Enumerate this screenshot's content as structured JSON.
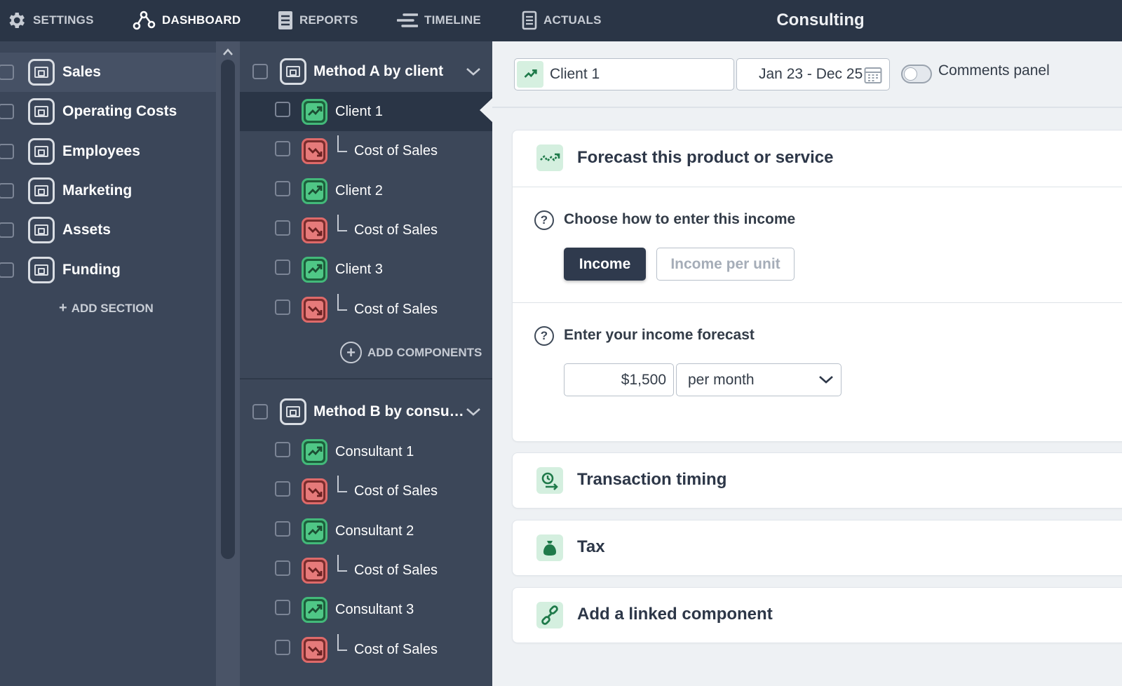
{
  "colors": {
    "topbar": "#2a3546",
    "sidebar": "#3b4659",
    "green_accent": "#43b97a",
    "red_accent": "#de6a6a",
    "primary_button": "#2f3a4d"
  },
  "nav": [
    {
      "label": "SETTINGS",
      "icon": "gear-icon"
    },
    {
      "label": "DASHBOARD",
      "icon": "network-nodes-icon",
      "active": true
    },
    {
      "label": "REPORTS",
      "icon": "report-icon"
    },
    {
      "label": "TIMELINE",
      "icon": "timeline-icon"
    },
    {
      "label": "ACTUALS",
      "icon": "actuals-document-icon"
    }
  ],
  "app_title": "Consulting",
  "sections": [
    {
      "label": "Sales",
      "active": true
    },
    {
      "label": "Operating Costs"
    },
    {
      "label": "Employees"
    },
    {
      "label": "Marketing"
    },
    {
      "label": "Assets"
    },
    {
      "label": "Funding"
    }
  ],
  "add_section_label": "ADD SECTION",
  "groups": [
    {
      "title": "Method A by client",
      "items": [
        {
          "label": "Client 1",
          "kind": "income",
          "active": true
        },
        {
          "label": "Cost of Sales",
          "kind": "cost"
        },
        {
          "label": "Client 2",
          "kind": "income"
        },
        {
          "label": "Cost of Sales",
          "kind": "cost"
        },
        {
          "label": "Client 3",
          "kind": "income"
        },
        {
          "label": "Cost of Sales",
          "kind": "cost"
        }
      ],
      "add_label": "ADD COMPONENTS"
    },
    {
      "title": "Method B by consu…",
      "items": [
        {
          "label": "Consultant 1",
          "kind": "income"
        },
        {
          "label": "Cost of Sales",
          "kind": "cost"
        },
        {
          "label": "Consultant 2",
          "kind": "income"
        },
        {
          "label": "Cost of Sales",
          "kind": "cost"
        },
        {
          "label": "Consultant 3",
          "kind": "income"
        },
        {
          "label": "Cost of Sales",
          "kind": "cost"
        }
      ]
    }
  ],
  "toolbar": {
    "component_select": "Client 1",
    "date_range": "Jan 23 - Dec 25",
    "comments_toggle_label": "Comments panel",
    "comments_on": false
  },
  "forecast_card": {
    "title": "Forecast this product or service",
    "q1": "Choose how to enter this income",
    "btn_income": "Income",
    "btn_income_per_unit": "Income per unit",
    "q2": "Enter your income forecast",
    "amount_value": "$1,500",
    "period_value": "per month"
  },
  "cards": [
    {
      "title": "Transaction timing",
      "icon": "transaction-timing-icon"
    },
    {
      "title": "Tax",
      "icon": "money-bag-icon"
    },
    {
      "title": "Add a linked component",
      "icon": "link-icon"
    }
  ]
}
